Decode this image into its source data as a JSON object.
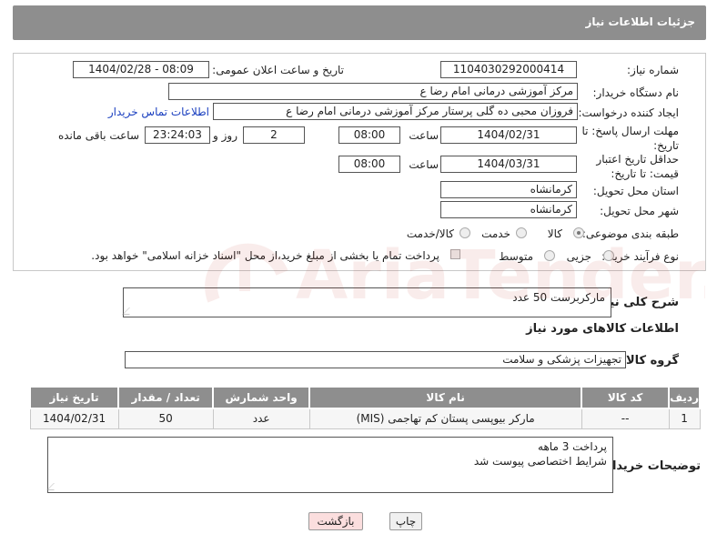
{
  "header": {
    "title": "جزئیات اطلاعات نیاز"
  },
  "form": {
    "need_number_label": "شماره نیاز:",
    "need_number": "1104030292000414",
    "announce_label": "تاریخ و ساعت اعلان عمومی:",
    "announce_value": "1404/02/28 - 08:09",
    "buyer_org_label": "نام دستگاه خریدار:",
    "buyer_org": "مرکز آموزشی  درمانی امام رضا  ع",
    "creator_label": "ایجاد کننده درخواست:",
    "creator": "فروزان محبی ده گلی پرستار مرکز آموزشی  درمانی امام رضا  ع",
    "contact_link": "اطلاعات تماس خریدار",
    "deadline_label": "مهلت ارسال پاسخ: تا تاریخ:",
    "deadline_date": "1404/02/31",
    "time_label": "ساعت",
    "deadline_time": "08:00",
    "days_value": "2",
    "days_label": "روز و",
    "remaining_time": "23:24:03",
    "remaining_label": "ساعت باقی مانده",
    "price_validity_label": "حداقل تاریخ اعتبار قیمت: تا تاریخ:",
    "price_validity_date": "1404/03/31",
    "price_validity_time": "08:00",
    "province_label": "استان محل تحویل:",
    "province": "کرمانشاه",
    "city_label": "شهر محل تحویل:",
    "city": "کرمانشاه",
    "category_label": "طبقه بندی موضوعی:",
    "category_options": [
      "کالا",
      "خدمت",
      "کالا/خدمت"
    ],
    "process_label": "نوع فرآیند خرید :",
    "process_options": [
      "جزیی",
      "متوسط"
    ],
    "payment_note": "پرداخت تمام یا بخشی از مبلغ خرید،از محل \"اسناد خزانه اسلامی\" خواهد بود."
  },
  "summary": {
    "label": "شرح کلی نیاز:",
    "value": "مارکربرست   50 عدد"
  },
  "goods_info_title": "اطلاعات کالاهای مورد نیاز",
  "group": {
    "label": "گروه کالا:",
    "value": "تجهیزات پزشکی و سلامت"
  },
  "table": {
    "headers": [
      "ردیف",
      "کد کالا",
      "نام کالا",
      "واحد شمارش",
      "تعداد / مقدار",
      "تاریخ نیاز"
    ],
    "rows": [
      [
        "1",
        "--",
        "مارکر بیوپسی پستان کم تهاجمی (MIS)",
        "عدد",
        "50",
        "1404/02/31"
      ]
    ]
  },
  "buyer_notes": {
    "label": "توضیحات خریدار:",
    "line1": "پرداخت 3 ماهه",
    "line2": "شرایط اختصاصی پیوست شد"
  },
  "buttons": {
    "print": "چاپ",
    "back": "بازگشت"
  },
  "watermark": {
    "text": "AriaTender.neT",
    "color": "#c0392b"
  }
}
